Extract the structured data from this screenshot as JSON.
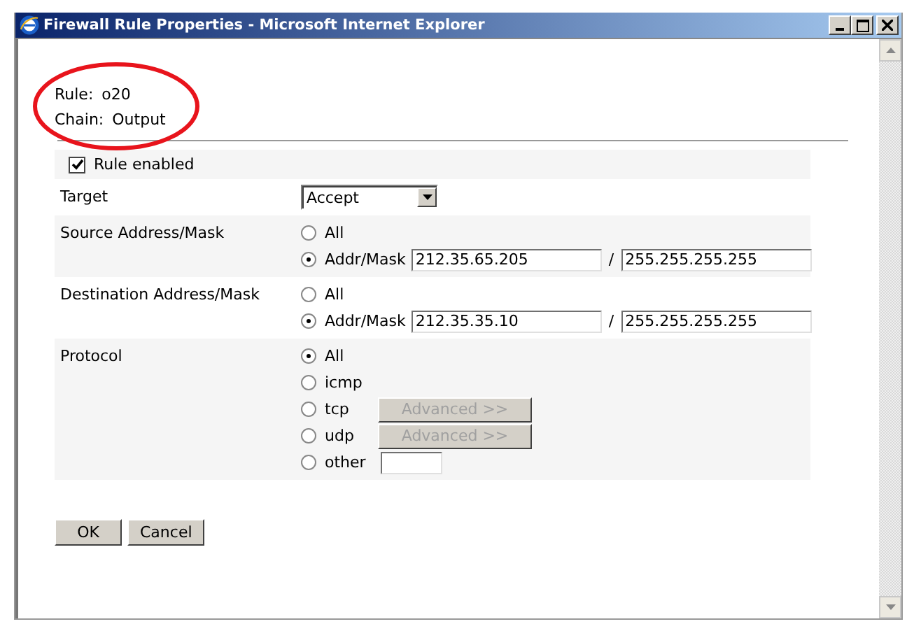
{
  "window": {
    "title": "Firewall Rule Properties - Microsoft Internet Explorer"
  },
  "header": [
    {
      "label": "Rule:",
      "value": "o20"
    },
    {
      "label": "Chain:",
      "value": "Output"
    }
  ],
  "rule_enabled": {
    "label": "Rule enabled",
    "checked": true
  },
  "fields": [
    {
      "kind": "select",
      "label": "Target",
      "value": "Accept"
    },
    {
      "kind": "radios",
      "label": "Source Address/Mask",
      "options": [
        {
          "kind": "plain",
          "label": "All",
          "selected": false
        },
        {
          "kind": "address",
          "label": "Addr/Mask",
          "selected": true,
          "address": "212.35.65.205",
          "separator": "/",
          "mask": "255.255.255.255"
        }
      ]
    },
    {
      "kind": "radios",
      "label": "Destination Address/Mask",
      "options": [
        {
          "kind": "plain",
          "label": "All",
          "selected": false
        },
        {
          "kind": "address",
          "label": "Addr/Mask",
          "selected": true,
          "address": "212.35.35.10",
          "separator": "/",
          "mask": "255.255.255.255"
        }
      ]
    },
    {
      "kind": "radios",
      "label": "Protocol",
      "options": [
        {
          "kind": "plain",
          "label": "All",
          "selected": true
        },
        {
          "kind": "plain",
          "label": "icmp",
          "selected": false
        },
        {
          "kind": "button",
          "label": "tcp",
          "selected": false,
          "button": {
            "label": "Advanced >>",
            "disabled": true
          }
        },
        {
          "kind": "button",
          "label": "udp",
          "selected": false,
          "button": {
            "label": "Advanced >>",
            "disabled": true
          }
        },
        {
          "kind": "entry",
          "label": "other",
          "selected": false
        }
      ]
    }
  ],
  "buttons": [
    "OK",
    "Cancel"
  ]
}
